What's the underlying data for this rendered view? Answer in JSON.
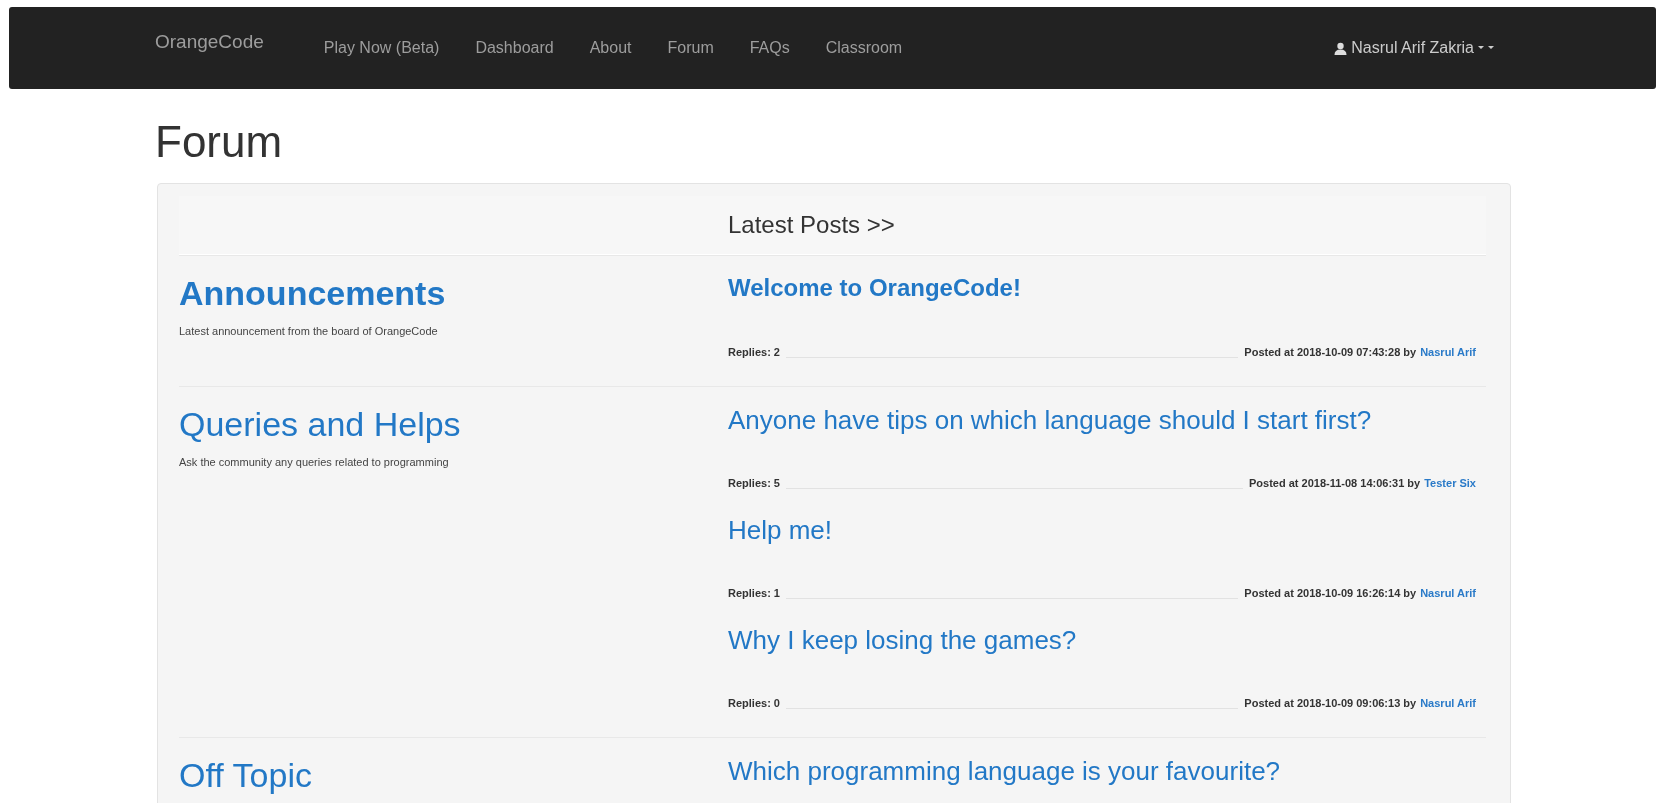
{
  "navbar": {
    "brand": "OrangeCode",
    "links": [
      {
        "label": "Play Now (Beta)",
        "selected": false
      },
      {
        "label": "Dashboard",
        "selected": false
      },
      {
        "label": "About",
        "selected": false
      },
      {
        "label": "Forum",
        "selected": false
      },
      {
        "label": "FAQs",
        "selected": false
      },
      {
        "label": "Classroom",
        "selected": false
      }
    ],
    "user": "Nasrul Arif Zakria"
  },
  "page_title": "Forum",
  "forum": {
    "header": "Latest Posts >>",
    "categories": [
      {
        "title": "Announcements",
        "emphasized": true,
        "description": "Latest announcement from the board of OrangeCode",
        "posts": [
          {
            "title": "Welcome to OrangeCode!",
            "emphasized": true,
            "replies": "Replies: 2",
            "posted": "Posted at 2018-10-09 07:43:28 by",
            "author": "Nasrul Arif"
          }
        ]
      },
      {
        "title": "Queries and Helps",
        "emphasized": false,
        "description": "Ask the community any queries related to programming",
        "posts": [
          {
            "title": "Anyone have tips on which language should I start first?",
            "emphasized": false,
            "replies": "Replies: 5",
            "posted": "Posted at 2018-11-08 14:06:31 by",
            "author": "Tester Six"
          },
          {
            "title": "Help me!",
            "emphasized": false,
            "replies": "Replies: 1",
            "posted": "Posted at 2018-10-09 16:26:14 by",
            "author": "Nasrul Arif"
          },
          {
            "title": "Why I keep losing the games?",
            "emphasized": false,
            "replies": "Replies: 0",
            "posted": "Posted at 2018-10-09 09:06:13 by",
            "author": "Nasrul Arif"
          }
        ]
      },
      {
        "title": "Off Topic",
        "emphasized": false,
        "posts": [
          {
            "title": "Which programming language is your favourite?",
            "emphasized": false
          }
        ]
      }
    ]
  }
}
